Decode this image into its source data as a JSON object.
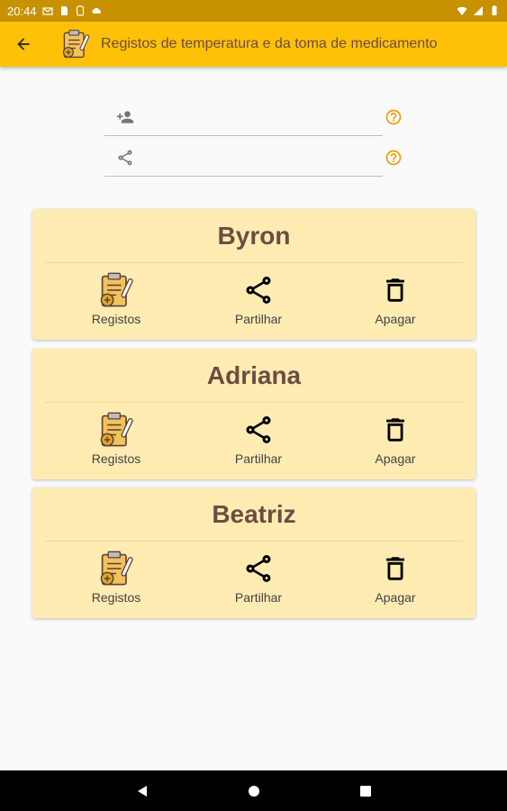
{
  "status_bar": {
    "time": "20:44"
  },
  "app_bar": {
    "title": "Registos de temperatura e da toma de medicamento",
    "back_icon": "arrow-back-icon",
    "logo_icon": "clipboard-thermometer-icon"
  },
  "fields": [
    {
      "icon": "person-add-icon",
      "value": "",
      "placeholder": "",
      "help_icon": "help-circle-icon"
    },
    {
      "icon": "share-icon",
      "value": "",
      "placeholder": "",
      "help_icon": "help-circle-icon"
    }
  ],
  "cards": [
    {
      "name": "Byron",
      "actions": [
        "Registos",
        "Partilhar",
        "Apagar"
      ]
    },
    {
      "name": "Adriana",
      "actions": [
        "Registos",
        "Partilhar",
        "Apagar"
      ]
    },
    {
      "name": "Beatriz",
      "actions": [
        "Registos",
        "Partilhar",
        "Apagar"
      ]
    }
  ],
  "colors": {
    "app_bar": "#ffc107",
    "status_bar": "#c79100",
    "card_background": "#ffecb3",
    "title_text": "#6d4c41",
    "help_icon": "#f29b00"
  }
}
